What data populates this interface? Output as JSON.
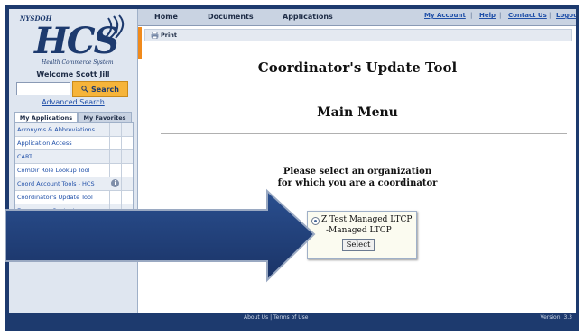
{
  "logo": {
    "small": "NYSDOH",
    "big": "HCS",
    "subtitle": "Health Commerce System"
  },
  "sidebar": {
    "welcome": "Welcome Scott Jill",
    "search_value": "",
    "search_button": "Search",
    "advanced_search": "Advanced Search",
    "tab_applications": "My Applications",
    "tab_favorites": "My Favorites",
    "items": [
      {
        "label": "Acronyms & Abbreviations"
      },
      {
        "label": "Application Access"
      },
      {
        "label": "CART"
      },
      {
        "label": "ComDir Role Lookup Tool"
      },
      {
        "label": "Coord Account Tools - HCS"
      },
      {
        "label": "Coordinator's Update Tool"
      },
      {
        "label": "Emergency Contacts"
      }
    ]
  },
  "nav": {
    "home": "Home",
    "documents": "Documents",
    "applications": "Applications",
    "my_account": "My Account",
    "help": "Help",
    "contact_us": "Contact Us",
    "logout": "Logout",
    "separator": "|"
  },
  "toolbar": {
    "print": "Print"
  },
  "main": {
    "title": "Coordinator's Update Tool",
    "menu_title": "Main Menu",
    "prompt_line1": "Please select an organization",
    "prompt_line2": "for which you are a coordinator",
    "org_line1": "Z Test Managed LTCP",
    "org_line2": "-Managed LTCP",
    "select_button": "Select"
  },
  "footer": {
    "links": "About Us | Terms of Use",
    "version": "Version: 3.3"
  },
  "colors": {
    "frame": "#1d3a6e",
    "accent_orange": "#f6b43a",
    "arrow": "#1d3a6e"
  }
}
